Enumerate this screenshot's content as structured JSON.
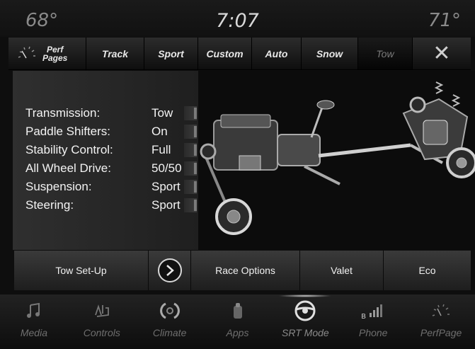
{
  "status": {
    "temp_left": "68°",
    "time": "7:07",
    "temp_right": "71°"
  },
  "tabs": [
    {
      "label_line1": "Perf",
      "label_line2": "Pages",
      "icon": "gauge-icon"
    },
    {
      "label": "Track"
    },
    {
      "label": "Sport"
    },
    {
      "label": "Custom"
    },
    {
      "label": "Auto"
    },
    {
      "label": "Snow"
    },
    {
      "label": "Tow",
      "state": "active"
    },
    {
      "label": "✕",
      "icon": "close-icon"
    }
  ],
  "settings": [
    {
      "label": "Transmission:",
      "value": "Tow"
    },
    {
      "label": "Paddle Shifters:",
      "value": "On"
    },
    {
      "label": "Stability Control:",
      "value": "Full"
    },
    {
      "label": "All Wheel Drive:",
      "value": "50/50"
    },
    {
      "label": "Suspension:",
      "value": "Sport"
    },
    {
      "label": "Steering:",
      "value": "Sport"
    }
  ],
  "actions": {
    "tow_setup": "Tow Set-Up",
    "race_options": "Race Options",
    "valet": "Valet",
    "eco": "Eco"
  },
  "nav": [
    {
      "label": "Media",
      "icon": "music-note-icon"
    },
    {
      "label": "Controls",
      "icon": "controls-icon"
    },
    {
      "label": "Climate",
      "icon": "climate-icon"
    },
    {
      "label": "Apps",
      "icon": "apps-icon"
    },
    {
      "label": "SRT Mode",
      "icon": "steering-wheel-icon",
      "state": "active"
    },
    {
      "label": "Phone",
      "icon": "phone-signal-icon"
    },
    {
      "label": "PerfPage",
      "icon": "gauge-icon"
    }
  ],
  "colors": {
    "background": "#0e0e0e",
    "text": "#f3f3f3",
    "muted": "#6f6f6f"
  }
}
